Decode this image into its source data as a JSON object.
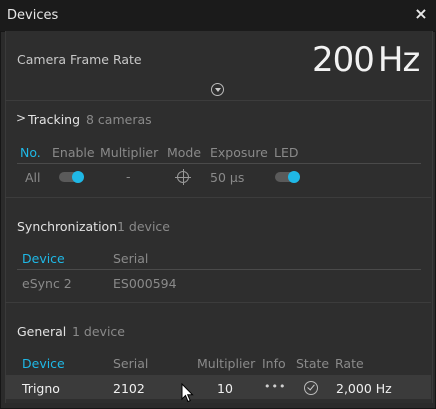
{
  "window": {
    "title": "Devices",
    "close_label": "×"
  },
  "camera": {
    "label": "Camera Frame Rate",
    "rate_value": "200",
    "rate_unit": "Hz"
  },
  "tracking": {
    "chevron": ">",
    "title": "Tracking",
    "count": "8 cameras",
    "columns": [
      "No.",
      "Enable",
      "Multiplier",
      "Mode",
      "Exposure",
      "LED"
    ],
    "row": {
      "no": "All",
      "enable_on": true,
      "multiplier": "-",
      "exposure": "50 µs",
      "led_on": true
    }
  },
  "sync": {
    "title": "Synchronization",
    "count": "1 device",
    "columns": [
      "Device",
      "Serial"
    ],
    "row": {
      "device": "eSync 2",
      "serial": "ES000594"
    }
  },
  "general": {
    "title": "General",
    "count": "1 device",
    "columns": [
      "Device",
      "Serial",
      "Multiplier",
      "Info",
      "State",
      "Rate"
    ],
    "row": {
      "device": "Trigno",
      "serial": "2102",
      "multiplier": "10",
      "info": "•••",
      "rate": "2,000 Hz"
    }
  },
  "colors": {
    "accent": "#1fb8e6",
    "background": "#2e2e2e",
    "titlebar": "#1b1b1b"
  }
}
